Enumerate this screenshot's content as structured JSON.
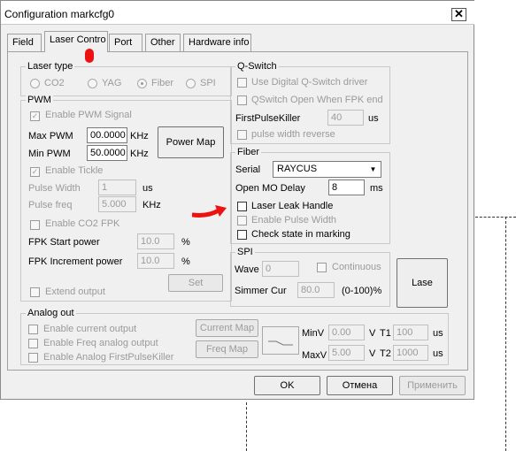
{
  "window": {
    "title": "Configuration markcfg0"
  },
  "tabs": [
    "Field",
    "Laser Contro",
    "Port",
    "Other",
    "Hardware info"
  ],
  "laser_type": {
    "label": "Laser type",
    "options": [
      "CO2",
      "YAG",
      "Fiber",
      "SPI"
    ],
    "selected": "Fiber"
  },
  "pwm": {
    "label": "PWM",
    "enable_signal": "Enable PWM Signal",
    "max_label": "Max PWM",
    "max_value": "00.0000",
    "max_unit": "KHz",
    "min_label": "Min PWM",
    "min_value": "50.0000",
    "min_unit": "KHz",
    "power_map_button": "Power Map",
    "enable_tickle": "Enable Tickle",
    "pulse_width_label": "Pulse Width",
    "pulse_width_value": "1",
    "pulse_width_unit": "us",
    "pulse_freq_label": "Pulse freq",
    "pulse_freq_value": "5.000",
    "pulse_freq_unit": "KHz",
    "enable_co2_fpk": "Enable CO2 FPK",
    "fpk_start_label": "FPK Start power",
    "fpk_start_value": "10.0",
    "fpk_start_unit": "%",
    "fpk_inc_label": "FPK Increment power",
    "fpk_inc_value": "10.0",
    "fpk_inc_unit": "%",
    "set_button": "Set",
    "extend_output": "Extend output"
  },
  "qswitch": {
    "label": "Q-Switch",
    "use_digital": "Use Digital Q-Switch driver",
    "open_when_fpk": "QSwitch Open When FPK end",
    "first_pulse_label": "FirstPulseKiller",
    "first_pulse_value": "40",
    "first_pulse_unit": "us",
    "pulse_width_reverse": "pulse width reverse"
  },
  "fiber": {
    "label": "Fiber",
    "serial_label": "Serial",
    "serial_value": "RAYCUS",
    "open_mo_label": "Open MO Delay",
    "open_mo_value": "8",
    "open_mo_unit": "ms",
    "laser_leak": "Laser Leak Handle",
    "enable_pulse_width": "Enable Pulse Width",
    "check_state": "Check state in marking"
  },
  "spi": {
    "label": "SPI",
    "wave_label": "Wave",
    "wave_value": "0",
    "continuous": "Continuous",
    "simmer_label": "Simmer Cur",
    "simmer_value": "80.0",
    "simmer_unit": "(0-100)%"
  },
  "lase_button": "Lase",
  "analog": {
    "label": "Analog out",
    "enable_current": "Enable current output",
    "enable_freq": "Enable Freq analog output",
    "enable_fpk": "Enable Analog FirstPulseKiller",
    "current_map_button": "Current Map",
    "freq_map_button": "Freq Map",
    "minv_label": "MinV",
    "minv_value": "0.00",
    "v_label1": "V",
    "t1_label": "T1",
    "t1_value": "100",
    "t1_unit": "us",
    "maxv_label": "MaxV",
    "maxv_value": "5.00",
    "v_label2": "V",
    "t2_label": "T2",
    "t2_value": "1000",
    "t2_unit": "us"
  },
  "footer": {
    "ok": "OK",
    "cancel": "Отмена",
    "apply": "Применить"
  },
  "colors": {
    "annotation": "#ee1111"
  },
  "icons": {
    "close": "close-icon",
    "dropdown": "chevron-down-icon",
    "check": "check-icon"
  }
}
